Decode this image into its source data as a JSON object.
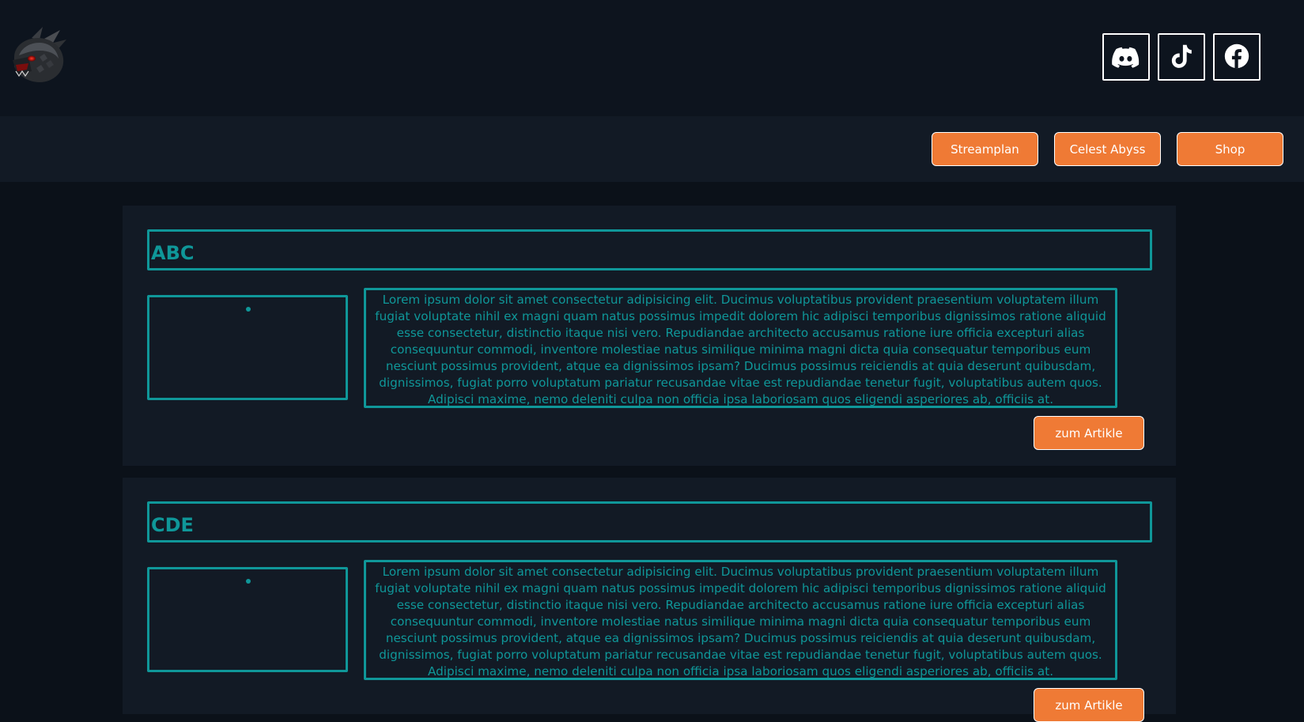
{
  "header": {
    "logo_icon": "dragon-head-logo",
    "social": [
      {
        "name": "discord",
        "icon": "discord-icon"
      },
      {
        "name": "tiktok",
        "icon": "tiktok-icon"
      },
      {
        "name": "facebook",
        "icon": "facebook-icon"
      }
    ]
  },
  "nav": {
    "items": [
      {
        "label": "Streamplan"
      },
      {
        "label": "Celest Abyss"
      },
      {
        "label": "Shop"
      }
    ]
  },
  "articles": [
    {
      "title": "ABC",
      "text": "Lorem ipsum dolor sit amet consectetur adipisicing elit. Ducimus voluptatibus provident praesentium voluptatem illum fugiat voluptate nihil ex magni quam natus possimus impedit dolorem hic adipisci temporibus dignissimos ratione aliquid esse consectetur, distinctio itaque nisi vero. Repudiandae architecto accusamus ratione iure officia excepturi alias consequuntur commodi, inventore molestiae natus similique minima magni dicta quia consequatur temporibus eum nesciunt possimus provident, atque ea dignissimos ipsam? Ducimus possimus reiciendis at quia deserunt quibusdam, dignissimos, fugiat porro voluptatum pariatur recusandae vitae est repudiandae tenetur fugit, voluptatibus autem quos. Adipisci maxime, nemo deleniti culpa non officia ipsa laboriosam quos eligendi asperiores ab, officiis at.",
      "button": "zum Artikle"
    },
    {
      "title": "CDE",
      "text": "Lorem ipsum dolor sit amet consectetur adipisicing elit. Ducimus voluptatibus provident praesentium voluptatem illum fugiat voluptate nihil ex magni quam natus possimus impedit dolorem hic adipisci temporibus dignissimos ratione aliquid esse consectetur, distinctio itaque nisi vero. Repudiandae architecto accusamus ratione iure officia excepturi alias consequuntur commodi, inventore molestiae natus similique minima magni dicta quia consequatur temporibus eum nesciunt possimus provident, atque ea dignissimos ipsam? Ducimus possimus reiciendis at quia deserunt quibusdam, dignissimos, fugiat porro voluptatum pariatur recusandae vitae est repudiandae tenetur fugit, voluptatibus autem quos. Adipisci maxime, nemo deleniti culpa non officia ipsa laboriosam quos eligendi asperiores ab, officiis at.",
      "button": "zum Artikle"
    }
  ],
  "colors": {
    "accent_orange": "#ef7a35",
    "teal": "#0f9799",
    "background": "#0b1119"
  }
}
